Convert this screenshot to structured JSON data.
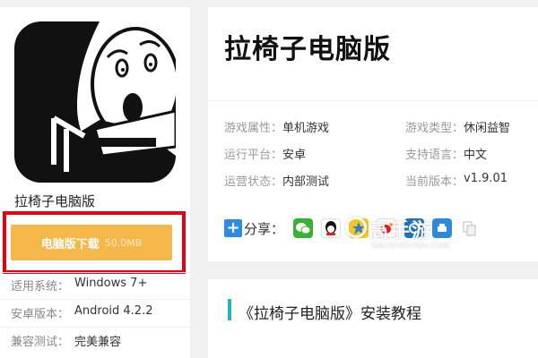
{
  "app": {
    "name": "拉椅子电脑版",
    "download_label": "电脑版下载",
    "download_size": "50.0MB"
  },
  "specs": [
    {
      "key": "适用系统：",
      "value": "Windows 7+"
    },
    {
      "key": "安卓版本：",
      "value": "Android 4.2.2"
    },
    {
      "key": "兼容测试：",
      "value": "完美兼容"
    }
  ],
  "attributes": {
    "left": [
      {
        "key": "游戏属性：",
        "value": "单机游戏"
      },
      {
        "key": "运行平台：",
        "value": "安卓"
      },
      {
        "key": "运营状态：",
        "value": "内部测试"
      }
    ],
    "right": [
      {
        "key": "游戏类型：",
        "value": "休闲益智"
      },
      {
        "key": "支持语言：",
        "value": "中文"
      },
      {
        "key": "当前版本：",
        "value": "v1.9.01"
      }
    ]
  },
  "share": {
    "plus": "+",
    "label": "分享：",
    "icons": [
      "wechat-icon",
      "qq-icon",
      "qzone-icon",
      "weibo-icon",
      "renren-icon",
      "print-icon",
      "copy-icon"
    ]
  },
  "tutorial": {
    "title": "《拉椅子电脑版》安装教程"
  },
  "watermark": {
    "text": "高手游",
    "sub": "GAOSHOUYOU.COM"
  },
  "colors": {
    "download": "#f5b64a",
    "highlight": "#e60012",
    "accent": "#23b4c8",
    "share_plus": "#2f8be0"
  }
}
